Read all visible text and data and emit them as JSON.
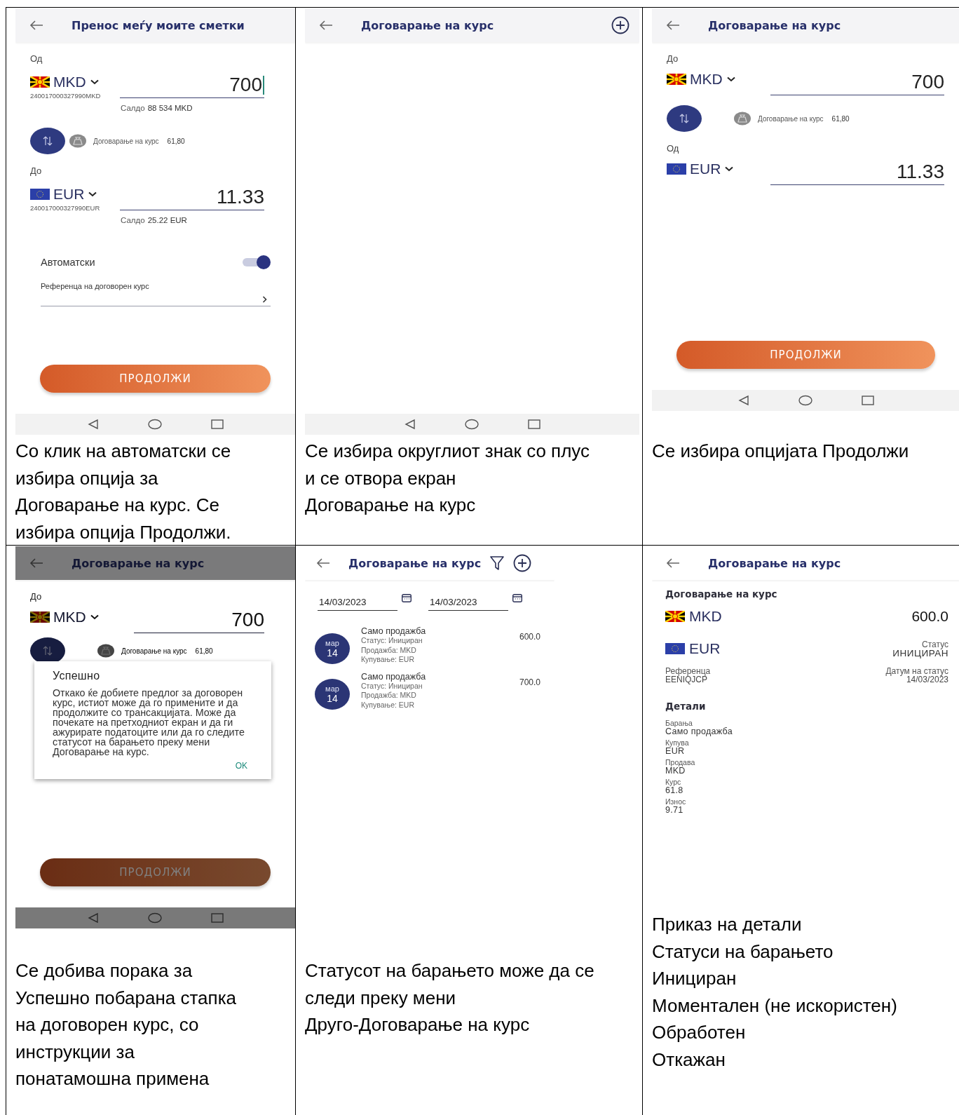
{
  "cells": [
    {
      "screen": {
        "kind": "form",
        "header": {
          "title": "Пренос меѓу моите сметки"
        },
        "sections": [
          {
            "kind": "currency",
            "label": "Од",
            "flag": {
              "kind": "mk"
            },
            "currency": "MKD",
            "account": "240017000327990MKD",
            "amount": "700",
            "cursor": true,
            "balance_label": "Салдо",
            "balance": "88 534 MKD"
          },
          {
            "kind": "rate",
            "text": "Договарање на курс",
            "value": "61,80"
          },
          {
            "kind": "currency",
            "label": "До",
            "flag": {
              "kind": "eu"
            },
            "currency": "EUR",
            "account": "240017000327990EUR",
            "amount": "11.33",
            "cursor": false,
            "balance_label": "Салдо",
            "balance": "25.22 EUR"
          },
          {
            "kind": "toggle",
            "label": "Автоматски",
            "on": true
          },
          {
            "kind": "select",
            "label": "Референца на договорен курс"
          },
          {
            "kind": "button",
            "label": "ПРОДОЛЖИ"
          }
        ]
      },
      "caption": [
        "Со клик на автоматски се\nизбира опција за\nДоговарање на курс. Се\nизбира опција Продолжи."
      ]
    },
    {
      "screen": {
        "kind": "form",
        "header": {
          "title": "Договарање на курс",
          "actions": [
            {
              "kind": "add"
            }
          ]
        }
      },
      "caption": [
        "Се избира округлиот знак со плус\nи се отвора екран\nДоговарање на курс"
      ]
    },
    {
      "screen": {
        "kind": "form",
        "header": {
          "title": "Договарање на курс"
        },
        "sections": [
          {
            "kind": "currency",
            "label": "До",
            "flag": {
              "kind": "mk"
            },
            "currency": "MKD",
            "amount": "700",
            "cursor": false
          },
          {
            "kind": "rate",
            "text": "Договарање на курс",
            "value": "61,80"
          },
          {
            "kind": "currency",
            "label": "Од",
            "flag": {
              "kind": "eu"
            },
            "currency": "EUR",
            "amount": "11.33",
            "cursor": false
          },
          {
            "kind": "button",
            "label": "ПРОДОЛЖИ"
          }
        ]
      },
      "caption": [
        "Се избира опцијата Продолжи"
      ]
    },
    {
      "screen": {
        "kind": "form",
        "header": {
          "title": "Договарање на курс"
        },
        "sections": [
          {
            "kind": "currency",
            "label": "До",
            "flag": {
              "kind": "mk"
            },
            "currency": "MKD",
            "amount": "700",
            "cursor": false
          },
          {
            "kind": "rate",
            "text": "Договарање на курс",
            "value": "61,80"
          },
          {
            "kind": "button",
            "label": "ПРОДОЛЖИ"
          }
        ],
        "dialog": {
          "title": "Успешно",
          "message": "Откако ќе добиете предлог за договорен курс, истиот може да го примените и да продолжите со трансакцијата. Може да почекате на претходниот екран и да ги ажурирате податоците или да го следите статусот на барањето преку мени Договарање на курс.",
          "button": "OK"
        }
      },
      "caption": [
        "Се добива порака за\nУспешно побарана стапка\nна договорен курс, со\nинструкции за\nпонатамошна примена"
      ]
    },
    {
      "screen": {
        "kind": "list",
        "header": {
          "title": "Договарање на курс",
          "actions": [
            {
              "kind": "filter"
            },
            {
              "kind": "add"
            }
          ]
        },
        "date_fields": [
          {
            "value": "14/03/2023"
          },
          {
            "value": "14/03/2023"
          }
        ],
        "items": [
          {
            "month": "мар",
            "day": "14",
            "title": "Само продажба",
            "lines": [
              "Статус: Иницирaн",
              "Продажба: MKD",
              "Купување: EUR"
            ],
            "amount": "600.0"
          },
          {
            "month": "мар",
            "day": "14",
            "title": "Само продажба",
            "lines": [
              "Статус: Иницирaн",
              "Продажба: MKD",
              "Купување: EUR"
            ],
            "amount": "700.0"
          }
        ]
      },
      "caption": [
        "Статусот на барањето може да се\nследи преку мени\nДруго-Договарање на курс"
      ]
    },
    {
      "screen": {
        "kind": "details",
        "header": {
          "title": "Договарање на курс"
        },
        "section_title": "Договарање на курс",
        "primary": {
          "flag": {
            "kind": "mk"
          },
          "currency": "MKD",
          "amount": "600.0"
        },
        "secondary": {
          "flag": {
            "kind": "eu"
          },
          "currency": "EUR",
          "status_label": "Статус",
          "status": "ИНИЦИРАН"
        },
        "reference": {
          "label": "Референца",
          "value": "EENIQJCP"
        },
        "status_date": {
          "label": "Датум на статус",
          "value": "14/03/2023"
        },
        "details_title": "Детали",
        "details": [
          {
            "label": "Барања",
            "value": "Само продажба"
          },
          {
            "label": "Купува",
            "value": "EUR"
          },
          {
            "label": "Продава",
            "value": "MKD"
          },
          {
            "label": "Курс",
            "value": "61.8"
          },
          {
            "label": "Износ",
            "value": "9.71"
          }
        ]
      },
      "caption": [
        "Приказ на детали",
        "Статуси на барањето",
        "Инициран",
        "Моментален (не искористен)",
        "Обработен",
        "Откажан"
      ]
    }
  ]
}
